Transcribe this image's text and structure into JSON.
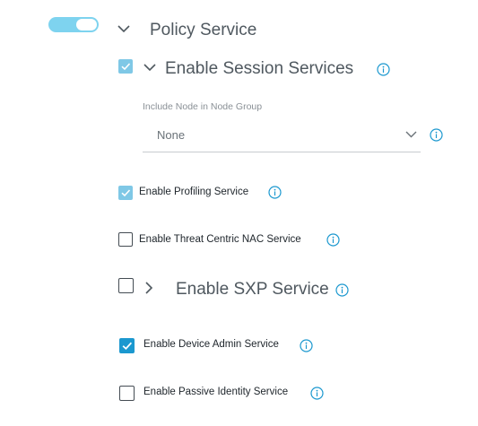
{
  "policy_service": {
    "toggle_on": true,
    "title": "Policy Service"
  },
  "session_services": {
    "checked": true,
    "label": "Enable Session Services",
    "node_group": {
      "label": "Include Node in Node Group",
      "selected": "None"
    }
  },
  "profiling": {
    "checked": true,
    "label": "Enable Profiling Service"
  },
  "threat_centric": {
    "checked": false,
    "label": "Enable Threat Centric NAC Service"
  },
  "sxp": {
    "checked": false,
    "label": "Enable SXP Service"
  },
  "device_admin": {
    "checked": true,
    "label": "Enable Device Admin Service"
  },
  "passive_identity": {
    "checked": false,
    "label": "Enable Passive Identity Service"
  },
  "colors": {
    "accent": "#1b98cf",
    "accent_light": "#7fc8e6",
    "toggle": "#7ed3ef"
  },
  "icons": {
    "info": "info-circle-icon",
    "expand": "chevron-down-icon",
    "collapse": "chevron-right-icon",
    "check": "checkmark-icon"
  }
}
